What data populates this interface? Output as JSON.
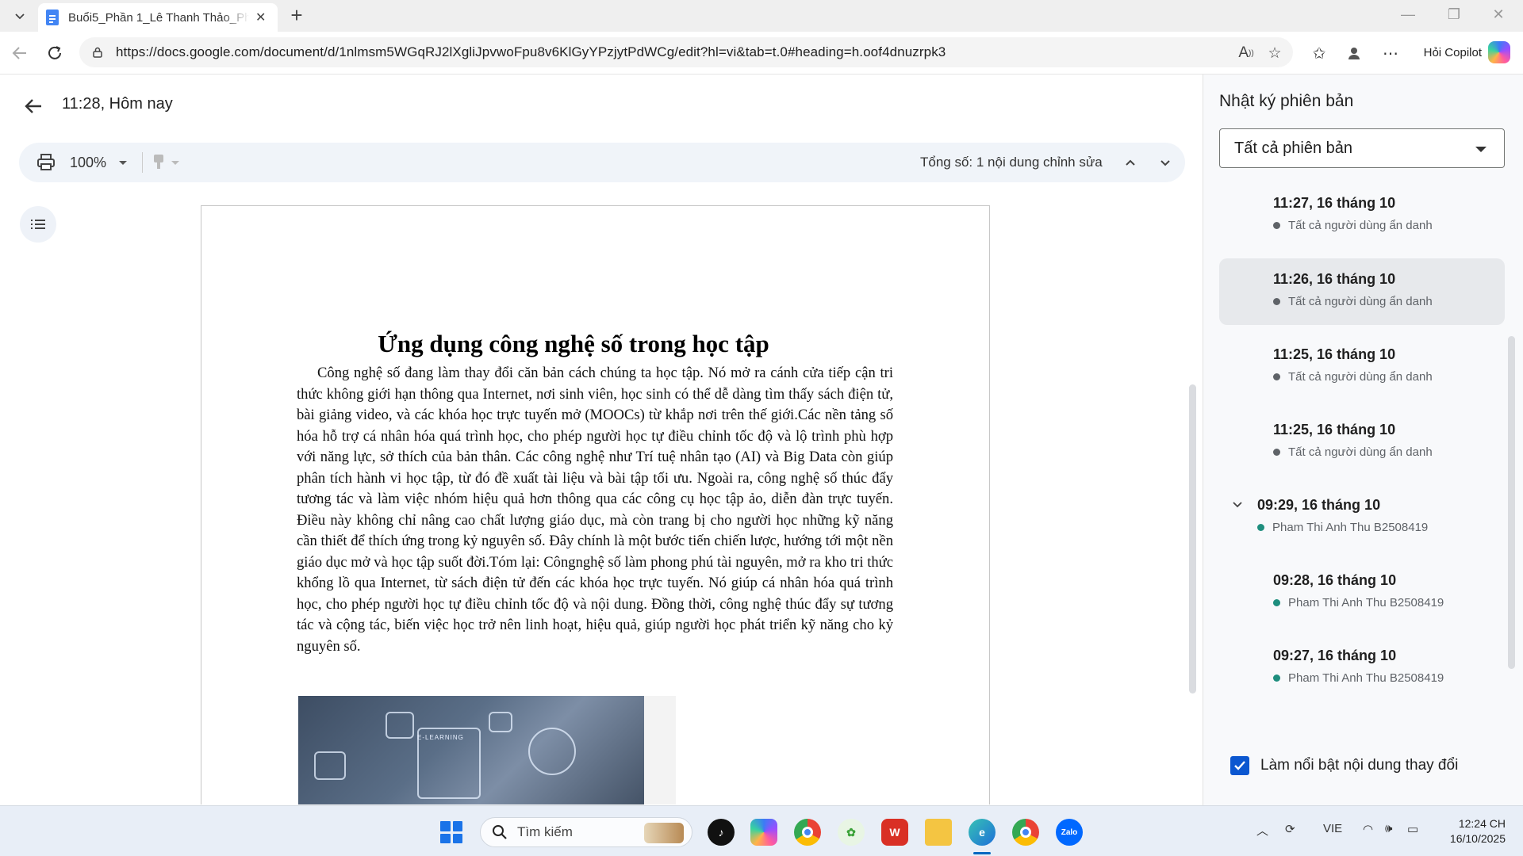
{
  "browser": {
    "tab_title": "Buổi5_Phần 1_Lê Thanh Thảo_Pha",
    "url": "https://docs.google.com/document/d/1nlmsm5WGqRJ2lXgliJpvwoFpu8v6KlGyYPzjytPdWCg/edit?hl=vi&tab=t.0#heading=h.oof4dnuzrpk3",
    "copilot_label": "Hỏi Copilot",
    "icons": [
      "tab-list-icon",
      "docs-icon",
      "close-icon",
      "plus-icon",
      "back-icon",
      "refresh-icon",
      "lock-icon",
      "read-aloud-icon",
      "star-icon",
      "favorites-icon",
      "profile-icon",
      "more-icon",
      "copilot-icon"
    ]
  },
  "header": {
    "version_time": "11:28, Hôm nay"
  },
  "docs_toolbar": {
    "zoom": "100%",
    "total_edits": "Tổng số: 1 nội dung chỉnh sửa"
  },
  "document": {
    "title": "Ứng dụng công nghệ số trong học tập",
    "body": "Công nghệ số đang làm thay đổi căn bản cách chúng ta học tập. Nó mở ra cánh cửa tiếp cận tri thức không giới hạn thông qua Internet, nơi sinh viên, học sinh có thể dễ dàng tìm thấy sách điện tử, bài giảng video, và các khóa học trực tuyến mở (MOOCs) từ khắp nơi trên thế giới.Các nền tảng số hóa hỗ trợ cá nhân hóa quá trình học, cho phép người học tự điều chỉnh tốc độ và lộ trình phù hợp với năng lực, sở thích của bản thân. Các công nghệ như Trí tuệ nhân tạo (AI) và Big Data còn giúp phân tích hành vi học tập, từ đó đề xuất tài liệu và bài tập tối ưu. Ngoài ra, công nghệ số thúc đẩy tương tác và làm việc nhóm hiệu quả hơn thông qua các công cụ học tập ảo, diễn đàn trực tuyến. Điều này không chỉ nâng cao chất lượng giáo dục, mà còn trang bị cho người học những kỹ năng cần thiết để thích ứng trong kỷ nguyên số. Đây chính là một bước tiến chiến lược, hướng tới một nền giáo dục mở và học tập suốt đời.Tóm lại: Côngnghệ số làm phong phú tài nguyên, mở ra kho tri thức khổng lồ qua Internet, từ sách điện tử đến các khóa học trực tuyến. Nó giúp cá nhân hóa quá trình học, cho phép người học tự điều chỉnh tốc độ và nội dung. Đồng thời, công nghệ thúc đẩy sự tương tác và cộng tác, biến việc học trở nên linh hoạt, hiệu quả, giúp người học phát triển kỹ năng cho kỷ nguyên số.",
    "image_text": "E-LEARNING"
  },
  "version_panel": {
    "title": "Nhật ký phiên bản",
    "filter": "Tất cả phiên bản",
    "versions": [
      {
        "time": "11:27, 16 tháng 10",
        "user": "Tất cả người dùng ẩn danh",
        "color": "#5f6368"
      },
      {
        "time": "11:26, 16 tháng 10",
        "user": "Tất cả người dùng ẩn danh",
        "color": "#5f6368",
        "selected": true
      },
      {
        "time": "11:25, 16 tháng 10",
        "user": "Tất cả người dùng ẩn danh",
        "color": "#5f6368"
      },
      {
        "time": "11:25, 16 tháng 10",
        "user": "Tất cả người dùng ẩn danh",
        "color": "#5f6368"
      },
      {
        "time": "09:29, 16 tháng 10",
        "user": "Pham Thi Anh Thu B2508419",
        "color": "#1e8e7e",
        "expanded": true
      },
      {
        "time": "09:28, 16 tháng 10",
        "user": "Pham Thi Anh Thu B2508419",
        "color": "#1e8e7e"
      },
      {
        "time": "09:27, 16 tháng 10",
        "user": "Pham Thi Anh Thu B2508419",
        "color": "#1e8e7e"
      }
    ],
    "highlight_label": "Làm nổi bật nội dung thay đổi",
    "highlight_checked": true
  },
  "taskbar": {
    "search_label": "Tìm kiếm",
    "language": "VIE",
    "time": "12:24 CH",
    "date": "16/10/2025"
  },
  "colors": {
    "accent": "#0b57d0",
    "docs_blue": "#4285f4",
    "selected_version": "#e7e9ec"
  }
}
